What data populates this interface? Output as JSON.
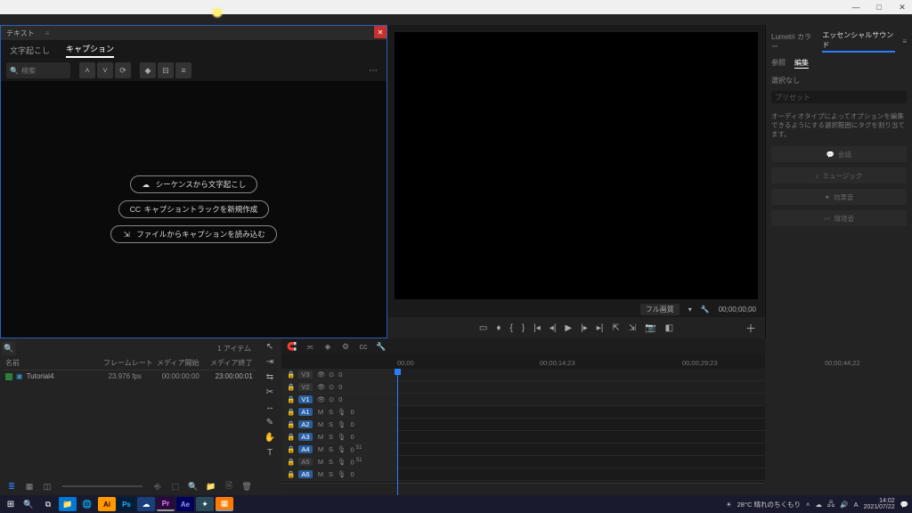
{
  "window": {
    "min": "—",
    "max": "□",
    "close": "✕"
  },
  "text_panel": {
    "title": "テキスト",
    "close": "✕",
    "tabs": {
      "transcribe": "文字起こし",
      "caption": "キャプション"
    },
    "search_placeholder": "検索",
    "btn1": "シーケンスから文字起こし",
    "btn2": "キャプショントラックを新規作成",
    "btn3": "ファイルからキャプションを読み込む"
  },
  "program": {
    "display_mode": "フル画質",
    "timecode": "00;00;00;00"
  },
  "essential": {
    "tab_lumetri": "Lumetri カラー",
    "tab_sound": "エッセンシャルサウンド",
    "sub_browse": "参照",
    "sub_edit": "編集",
    "no_selection": "選択なし",
    "preset_label": "プリセット",
    "desc": "オーディオタイプによってオプションを編集できるようにする選択範囲にタグを割り当てます。",
    "b1": "会話",
    "b2": "ミュージック",
    "b3": "効果音",
    "b4": "環境音"
  },
  "project": {
    "items_label": "1 アイテム",
    "col_name": "名前",
    "col_fps": "フレームレート",
    "col_start": "メディア開始",
    "col_end": "メディア終了",
    "row": {
      "name": "Tutorial4",
      "fps": "23.976 fps",
      "start": "00:00:00:00",
      "end": "23:00:00:01"
    }
  },
  "timeline": {
    "t0": "00;00",
    "t1": "00;00;14;23",
    "t2": "00;00;29;23",
    "t3": "00;00;44;22",
    "tracks_v": [
      "V3",
      "V2",
      "V1"
    ],
    "tracks_a": [
      "A1",
      "A2",
      "A3",
      "A4",
      "A5",
      "A6"
    ]
  },
  "taskbar": {
    "weather": "28°C 晴れのちくもり",
    "time": "14:02",
    "date": "2021/07/22"
  }
}
